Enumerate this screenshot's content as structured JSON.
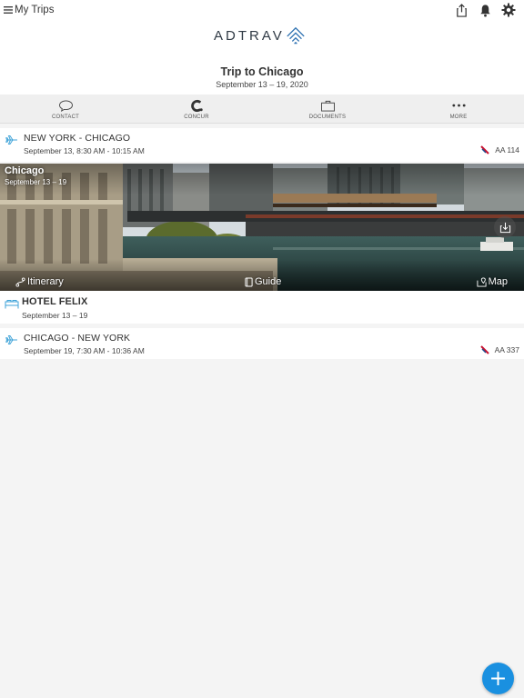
{
  "header": {
    "back_label": "My Trips",
    "logo_text": "ADTRAV"
  },
  "trip": {
    "title": "Trip to Chicago",
    "dates": "September 13 – 19, 2020"
  },
  "tabs": [
    {
      "label": "CONTACT",
      "icon": "chat-bubble-icon"
    },
    {
      "label": "CONCUR",
      "icon": "concur-icon"
    },
    {
      "label": "DOCUMENTS",
      "icon": "briefcase-icon"
    },
    {
      "label": "MORE",
      "icon": "more-dots-icon"
    }
  ],
  "itinerary": {
    "outbound_flight": {
      "route": "NEW YORK - CHICAGO",
      "time": "September 13, 8:30 AM - 10:15 AM",
      "flight_number": "AA 114"
    },
    "destination": {
      "city": "Chicago",
      "dates": "September 13 – 19",
      "actions": {
        "itinerary": "Itinerary",
        "guide": "Guide",
        "map": "Map"
      }
    },
    "hotel": {
      "name": "HOTEL FELIX",
      "dates": "September 13 – 19"
    },
    "return_flight": {
      "route": "CHICAGO - NEW YORK",
      "time": "September 19, 7:30 AM - 10:36 AM",
      "flight_number": "AA 337"
    }
  },
  "colors": {
    "accent": "#1a90e0",
    "flight_icon": "#3fa3d8",
    "logo_mark": "#2a6fb0"
  }
}
